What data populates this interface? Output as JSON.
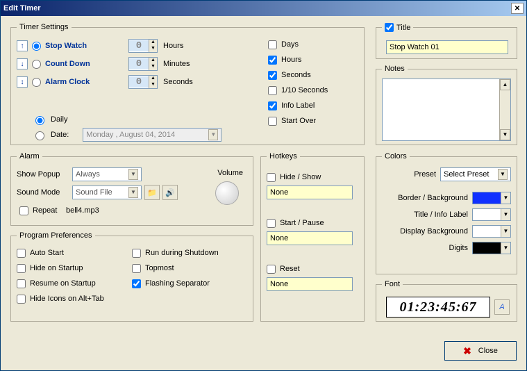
{
  "window": {
    "title": "Edit Timer"
  },
  "timer_settings": {
    "legend": "Timer Settings",
    "modes": {
      "stop_watch": "Stop Watch",
      "count_down": "Count Down",
      "alarm_clock": "Alarm Clock"
    },
    "spinners": {
      "hours": "0",
      "minutes": "0",
      "seconds": "0"
    },
    "units": {
      "hours": "Hours",
      "minutes": "Minutes",
      "seconds": "Seconds"
    },
    "display_opts": {
      "days": "Days",
      "hours": "Hours",
      "seconds": "Seconds",
      "tenth": "1/10 Seconds",
      "info_label": "Info Label",
      "start_over": "Start Over"
    },
    "schedule": {
      "daily": "Daily",
      "date": "Date:",
      "date_value": "Monday  ,   August   04, 2014"
    }
  },
  "alarm": {
    "legend": "Alarm",
    "show_popup": "Show Popup",
    "show_popup_value": "Always",
    "sound_mode": "Sound Mode",
    "sound_mode_value": "Sound File",
    "repeat": "Repeat",
    "sound_file": "bell4.mp3",
    "volume": "Volume"
  },
  "prog": {
    "legend": "Program Preferences",
    "auto_start": "Auto Start",
    "hide_startup": "Hide on Startup",
    "resume_startup": "Resume on Startup",
    "hide_icons": "Hide Icons on Alt+Tab",
    "run_shutdown": "Run during Shutdown",
    "topmost": "Topmost",
    "flashing_sep": "Flashing Separator"
  },
  "hotkeys": {
    "legend": "Hotkeys",
    "hide_show": "Hide / Show",
    "start_pause": "Start / Pause",
    "reset": "Reset",
    "none": "None"
  },
  "title_box": {
    "legend": "Title",
    "value": "Stop Watch 01"
  },
  "notes": {
    "legend": "Notes"
  },
  "colors": {
    "legend": "Colors",
    "preset": "Preset",
    "preset_value": "Select Preset",
    "border_bg": "Border / Background",
    "title_info": "Title / Info Label",
    "display_bg": "Display Background",
    "digits": "Digits",
    "swatches": {
      "border_bg": "#1030ff",
      "title_info": "#ffffff",
      "display_bg": "#ffffff",
      "digits": "#000000"
    }
  },
  "font": {
    "legend": "Font",
    "sample": "01:23:45:67"
  },
  "close": "Close"
}
